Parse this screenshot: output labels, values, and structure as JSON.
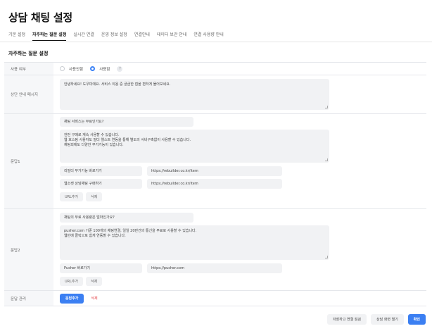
{
  "page": {
    "title": "상담 채팅 설정"
  },
  "tabs": [
    {
      "label": "기본 설정"
    },
    {
      "label": "자주하는 질문 설정"
    },
    {
      "label": "실시간 연결"
    },
    {
      "label": "운영 정보 설정"
    },
    {
      "label": "연결안내"
    },
    {
      "label": "데이터 보관 안내"
    },
    {
      "label": "연결 사용량 안내"
    }
  ],
  "section": {
    "title": "자주하는 질문 설정"
  },
  "usage": {
    "label": "사용 여부",
    "options": [
      "사용안함",
      "사용함"
    ],
    "selected": "사용함",
    "help": "?"
  },
  "intro": {
    "label": "상단 안내 메시지",
    "text": "안녕하세요! 도우미에요. 서비스 이용 중 궁금한 점을 편하게 물어보세요."
  },
  "faqs": [
    {
      "label": "문답1",
      "question": "채팅 서비스는 무료인가요?",
      "answer_lines": [
        "한번 구매로 계속 사용할 수 있습니다.",
        "웹 호스팅 사용자도 빌더 웰스트 연동을 통해 별도의 서비구축없이 사용할 수 있습니다.",
        "채팅외에도 다양한 부가기능이 있습니다."
      ],
      "links": [
        {
          "name": "리빌더 부가기능 바로가기",
          "url": "https://rebuilder.co.kr/item"
        },
        {
          "name": "웹소켓 상담채팅 구매하기",
          "url": "https://rebuilder.co.kr/item"
        }
      ]
    },
    {
      "label": "문답2",
      "question": "채팅의 무료 사용량은 얼마인가요?",
      "answer_lines": [
        "pusher.com 기준 100개의 채팅연결, 일일 20만건의 통신을 무료로 사용할 수 있습니다.",
        "웹빈에 클릭으로 쉽게 연동할 수 있습니다."
      ],
      "links": [
        {
          "name": "Pusher 바로가기",
          "url": "https://pusher.com"
        }
      ]
    }
  ],
  "buttons": {
    "add_url": "URL추가",
    "delete": "삭제"
  },
  "manage": {
    "label": "문답 관리",
    "add": "문답추가",
    "delete": "삭제"
  },
  "footer": {
    "save_check": "저장하고 연결 점검",
    "open_chat": "상담 화면 열기",
    "confirm": "확인"
  },
  "colors": {
    "accent": "#3b7ff2",
    "danger": "#e5484d"
  }
}
